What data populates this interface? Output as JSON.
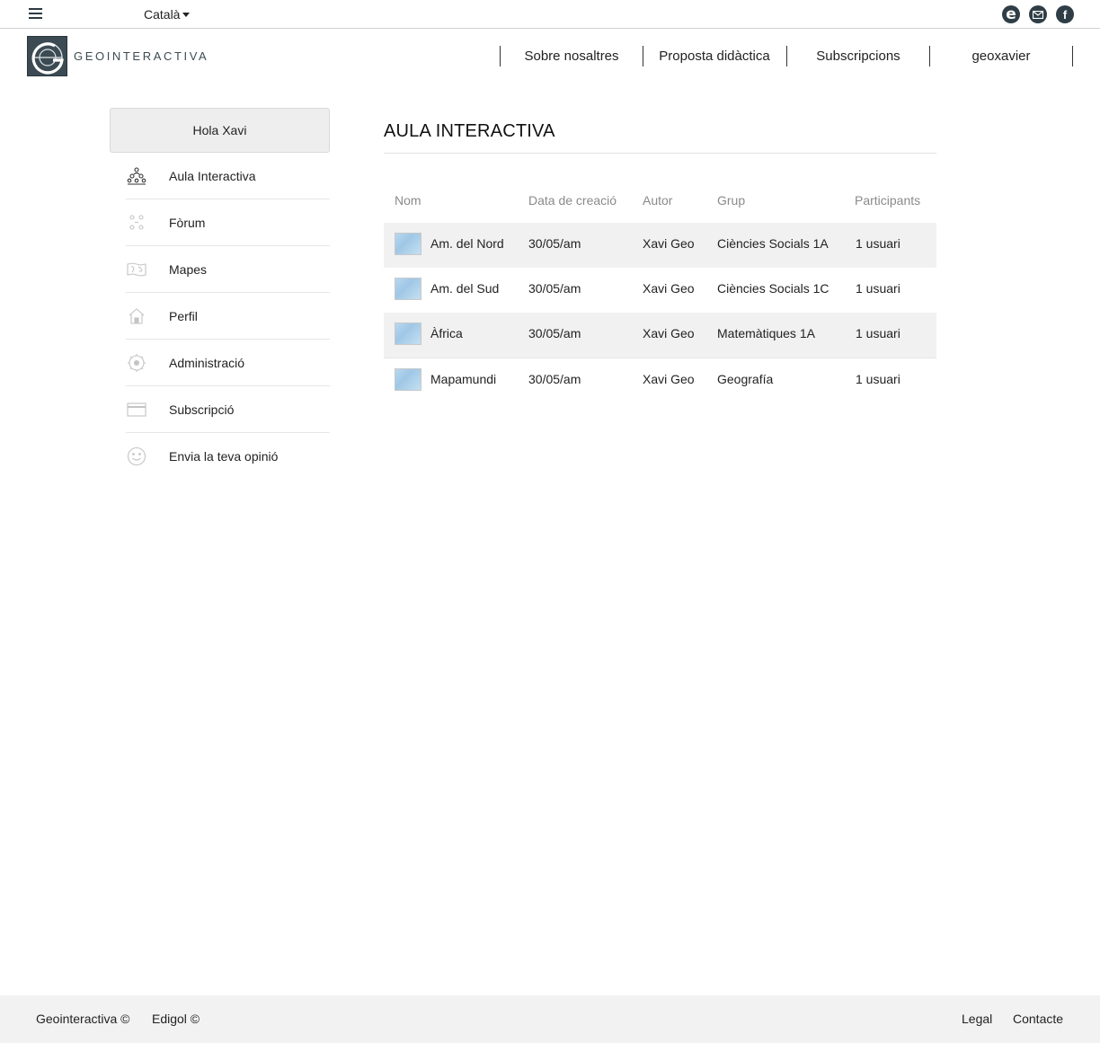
{
  "topbar": {
    "language": "Català",
    "social": [
      {
        "icon": "edigol-e-icon",
        "glyph": "e"
      },
      {
        "icon": "mail-icon",
        "glyph": ""
      },
      {
        "icon": "facebook-icon",
        "glyph": "f"
      }
    ]
  },
  "header": {
    "logo_text": "GEOINTERACTIVA",
    "nav": [
      "Sobre nosaltres",
      "Proposta didàctica",
      "Subscripcions",
      "geoxavier"
    ]
  },
  "sidebar": {
    "greeting": "Hola Xavi",
    "items": [
      {
        "label": "Aula Interactiva",
        "icon": "classroom-icon"
      },
      {
        "label": "Fòrum",
        "icon": "forum-icon"
      },
      {
        "label": "Mapes",
        "icon": "world-map-icon"
      },
      {
        "label": "Perfil",
        "icon": "home-icon"
      },
      {
        "label": "Administració",
        "icon": "gear-icon"
      },
      {
        "label": "Subscripció",
        "icon": "credit-card-icon"
      },
      {
        "label": "Envia la teva opinió",
        "icon": "smiley-icon"
      }
    ]
  },
  "main": {
    "title": "AULA INTERACTIVA",
    "columns": [
      "Nom",
      "Data de creació",
      "Autor",
      "Grup",
      "Participants"
    ],
    "rows": [
      {
        "name": "Am. del Nord",
        "date": "30/05/am",
        "author": "Xavi Geo",
        "group": "Ciències Socials 1A",
        "participants": "1 usuari"
      },
      {
        "name": "Am. del Sud",
        "date": "30/05/am",
        "author": "Xavi Geo",
        "group": "Ciències Socials 1C",
        "participants": "1 usuari"
      },
      {
        "name": "Àfrica",
        "date": "30/05/am",
        "author": "Xavi Geo",
        "group": "Matemàtiques 1A",
        "participants": "1 usuari"
      },
      {
        "name": "Mapamundi",
        "date": "30/05/am",
        "author": "Xavi Geo",
        "group": "Geografía",
        "participants": "1 usuari"
      }
    ]
  },
  "footer": {
    "left": [
      "Geointeractiva ©",
      "Edigol ©"
    ],
    "right": [
      "Legal",
      "Contacte"
    ]
  },
  "colors": {
    "brand_dark": "#3c4b53",
    "row_alt": "#f1f1f1",
    "footer_bg": "#f2f2f2"
  }
}
